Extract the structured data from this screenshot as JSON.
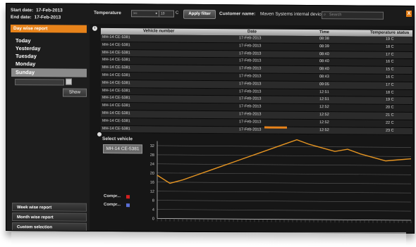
{
  "header": {
    "start_date_label": "Start date:",
    "start_date_value": "17-Feb-2013",
    "end_date_label": "End date:",
    "end_date_value": "17-Feb-2013",
    "temperature_label": "Temperature",
    "temperature_operator": ">=",
    "temperature_value": "10",
    "temperature_unit": "C",
    "apply_filter_label": "Apply filter",
    "customer_name_label": "Customer name:",
    "customer_name_value": "Maven Systems internal devices",
    "search_placeholder": "Search",
    "close_label": "X"
  },
  "sidebar": {
    "day_wise_report": "Day wise report",
    "days": [
      "Today",
      "Yesterday",
      "Tuesday",
      "Monday",
      "Sunday"
    ],
    "selected_day": "Sunday",
    "show_button": "Show",
    "week_wise_report": "Week wise report",
    "month_wise_report": "Month wise report",
    "custom_selection": "Custom selection"
  },
  "table": {
    "columns": [
      "Vehicle number",
      "Date",
      "Time",
      "Temperature status"
    ],
    "rows": [
      [
        "MH-14 CE-5381",
        "17-Feb-2013",
        "08:38",
        "19  C"
      ],
      [
        "MH-14 CE-5381",
        "17-Feb-2013",
        "08:39",
        "18  C"
      ],
      [
        "MH-14 CE-5381",
        "17-Feb-2013",
        "08:40",
        "17  C"
      ],
      [
        "MH-14 CE-5381",
        "17-Feb-2013",
        "08:40",
        "16  C"
      ],
      [
        "MH-14 CE-5381",
        "17-Feb-2013",
        "08:40",
        "15  C"
      ],
      [
        "MH-14 CE-5381",
        "17-Feb-2013",
        "08:43",
        "16  C"
      ],
      [
        "MH-14 CE-5381",
        "17-Feb-2013",
        "09:05",
        "17  C"
      ],
      [
        "MH-14 CE-5381",
        "17-Feb-2013",
        "12:51",
        "18  C"
      ],
      [
        "MH-14 CE-5381",
        "17-Feb-2013",
        "12:51",
        "19  C"
      ],
      [
        "MH-14 CE-5381",
        "17-Feb-2013",
        "12:52",
        "20  C"
      ],
      [
        "MH-14 CE-5381",
        "17-Feb-2013",
        "12:52",
        "21  C"
      ],
      [
        "MH-14 CE-5381",
        "17-Feb-2013",
        "12:52",
        "22  C"
      ],
      [
        "MH-14 CE-5381",
        "17-Feb-2013",
        "12:52",
        "23  C"
      ]
    ]
  },
  "chart_panel": {
    "select_vehicle_label": "Select vehicle",
    "selected_vehicle": "MH-14 CE-5381",
    "legend": [
      {
        "label": "Compr...",
        "color": "#d42020"
      },
      {
        "label": "Compr...",
        "color": "#5b6fd6"
      }
    ]
  },
  "colors": {
    "accent": "#e8831a",
    "line": "#e69522",
    "background": "#161616"
  },
  "chart_data": {
    "type": "line",
    "y_ticks": [
      0,
      4,
      8,
      12,
      16,
      20,
      24,
      28,
      32
    ],
    "ylim": [
      0,
      34
    ],
    "grid": true,
    "series": [
      {
        "values": [
          19,
          15.5,
          17,
          19,
          21,
          23,
          25,
          27,
          29,
          31,
          33,
          35,
          33,
          31.5,
          30,
          31,
          29,
          27.5,
          26,
          26.5,
          27
        ]
      }
    ]
  }
}
